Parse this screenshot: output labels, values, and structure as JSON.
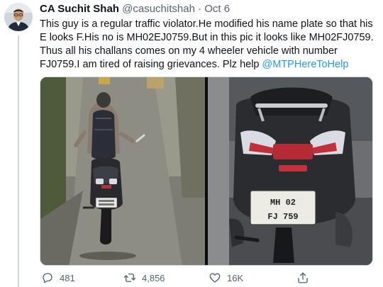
{
  "tweet": {
    "author_name": "CA Suchit Shah",
    "handle": "@casuchitshah",
    "separator": "·",
    "time": "Oct 6",
    "body_text": "This guy is a regular traffic violator.He modified his name plate so that his E looks F.His no is MH02EJ0759.But in this pic it looks like MH02FJ0759. Thus all his challans comes on my 4 wheeler vehicle with number FJ0759.I am tired of raising grievances. Plz help ",
    "mention": "@MTPHereToHelp"
  },
  "media": {
    "plate_line1": "MH 02",
    "plate_line2": "FJ 759"
  },
  "actions": {
    "reply_count": "481",
    "retweet_count": "4,856",
    "like_count": "16K",
    "reply_icon": "reply-icon",
    "retweet_icon": "retweet-icon",
    "like_icon": "heart-icon",
    "share_icon": "share-icon"
  },
  "colors": {
    "link": "#1d9bf0",
    "secondary_text": "#536471",
    "thread_line": "#cfd9de"
  }
}
